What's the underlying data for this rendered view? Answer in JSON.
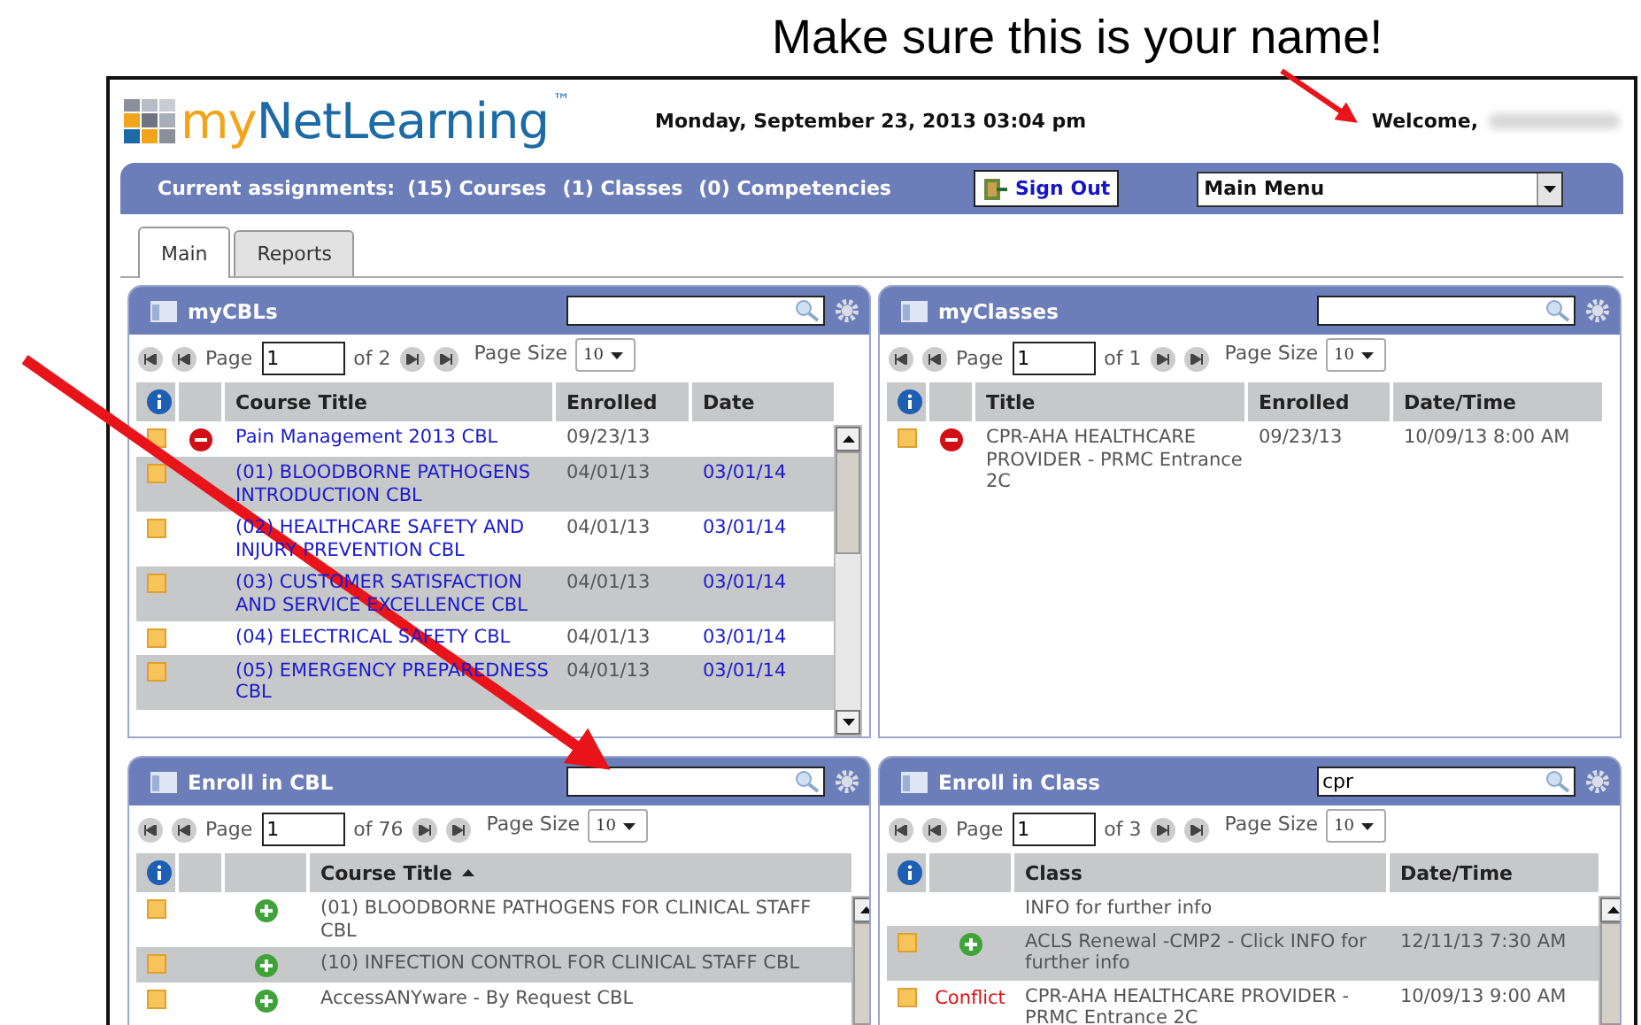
{
  "annotation": {
    "note": "Make sure this is your name!"
  },
  "header": {
    "logo_prefix": "my",
    "logo_main": "NetLearning",
    "trademark": "™",
    "date": "Monday, September 23, 2013 03:04 pm",
    "welcome": "Welcome,"
  },
  "nav": {
    "assignments_label": "Current assignments:",
    "links": [
      "(15) Courses",
      "(1) Classes",
      "(0) Competencies"
    ],
    "sign_out": "Sign Out",
    "menu": "Main Menu"
  },
  "tabs": [
    {
      "label": "Main",
      "selected": true
    },
    {
      "label": "Reports",
      "selected": false
    }
  ],
  "panels": [
    {
      "title": "myCBLs",
      "page_label": "Page",
      "page": "1",
      "of": "of 2",
      "page_size_label": "Page Size",
      "page_size": "10",
      "scrollbar": true,
      "columns": [
        {
          "label": "Course Title",
          "link": true
        },
        {
          "label": "Enrolled",
          "link": false
        },
        {
          "label": "Date",
          "link": true
        }
      ],
      "rows": [
        {
          "note": true,
          "kind": "drop",
          "cells": [
            "Pain Management 2013 CBL",
            "09/23/13"
          ]
        },
        {
          "note": true,
          "cells": [
            "(01) BLOODBORNE PATHOGENS INTRODUCTION CBL",
            "04/01/13",
            "03/01/14"
          ]
        },
        {
          "note": true,
          "cells": [
            "(02) HEALTHCARE SAFETY AND INJURY PREVENTION CBL",
            "04/01/13",
            "03/01/14"
          ]
        },
        {
          "note": true,
          "cells": [
            "(03) CUSTOMER SATISFACTION AND SERVICE EXCELLENCE CBL",
            "04/01/13",
            "03/01/14"
          ]
        },
        {
          "note": true,
          "cells": [
            "(04) ELECTRICAL SAFETY CBL",
            "04/01/13",
            "03/01/14"
          ]
        },
        {
          "note": true,
          "cells": [
            "(05) EMERGENCY PREPAREDNESS CBL",
            "04/01/13",
            "03/01/14"
          ]
        }
      ]
    },
    {
      "title": "myClasses",
      "page_label": "Page",
      "page": "1",
      "of": "of 1",
      "page_size_label": "Page Size",
      "page_size": "10",
      "scrollbar": false,
      "columns": [
        {
          "label": "Title",
          "link": false
        },
        {
          "label": "Enrolled",
          "link": false
        },
        {
          "label": "Date/Time",
          "link": false
        }
      ],
      "rows": [
        {
          "note": true,
          "kind": "drop",
          "cells": [
            "CPR-AHA HEALTHCARE PROVIDER - PRMC Entrance 2C",
            "09/23/13",
            "10/09/13 8:00 AM"
          ]
        }
      ]
    },
    {
      "title": "Enroll in CBL",
      "page_label": "Page",
      "page": "1",
      "of": "of 76",
      "page_size_label": "Page Size",
      "page_size": "10",
      "scrollbar": true,
      "columns": [
        {
          "label": "Course Title",
          "link": false,
          "sorted": true
        }
      ],
      "rows": [
        {
          "note": true,
          "kind": "enroll",
          "cells": [
            "(01) BLOODBORNE PATHOGENS FOR CLINICAL STAFF CBL"
          ]
        },
        {
          "note": true,
          "kind": "enroll",
          "cells": [
            "(10) INFECTION CONTROL FOR CLINICAL STAFF CBL"
          ]
        },
        {
          "note": true,
          "kind": "enroll",
          "cells": [
            "AccessANYware - By Request CBL"
          ]
        }
      ]
    },
    {
      "title": "Enroll in Class",
      "search": "cpr",
      "page_label": "Page",
      "page": "1",
      "of": "of 3",
      "page_size_label": "Page Size",
      "page_size": "10",
      "scrollbar": true,
      "columns": [
        {
          "label": "Class",
          "link": false
        },
        {
          "label": "Date/Time",
          "link": false
        }
      ],
      "rows": [
        {
          "note": false,
          "cells": [
            "INFO for further info"
          ]
        },
        {
          "note": true,
          "kind": "enroll",
          "cells": [
            "ACLS Renewal -CMP2 - Click INFO for further info",
            "12/11/13 7:30 AM"
          ]
        },
        {
          "note": true,
          "kind": "conflict",
          "action_label": "Conflict",
          "cells": [
            "CPR-AHA HEALTHCARE PROVIDER - PRMC Entrance 2C",
            "10/09/13 9:00 AM"
          ]
        }
      ]
    }
  ]
}
